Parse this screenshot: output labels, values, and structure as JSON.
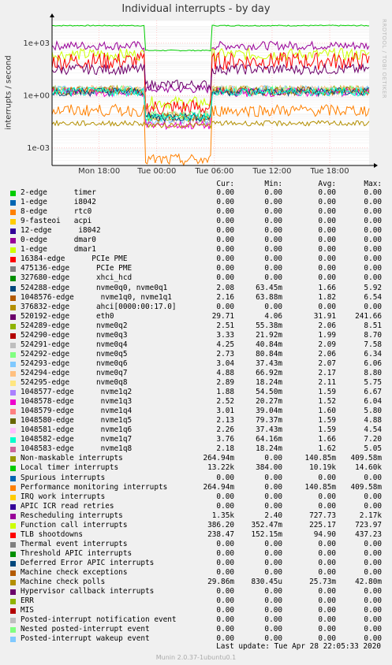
{
  "title": "Individual interrupts - by day",
  "y_axis_label": "interrupts / second",
  "side_label": "RRDTOOL / TOBI OETIKER",
  "table_headers": [
    "Cur:",
    "Min:",
    "Avg:",
    "Max:"
  ],
  "rows": [
    {
      "name": "2-edge      timer",
      "color": "#00cc00",
      "cur": "0.00",
      "min": "0.00",
      "avg": "0.00",
      "max": "0.00"
    },
    {
      "name": "1-edge      i8042",
      "color": "#0066b3",
      "cur": "0.00",
      "min": "0.00",
      "avg": "0.00",
      "max": "0.00"
    },
    {
      "name": "8-edge      rtc0",
      "color": "#ff8000",
      "cur": "0.00",
      "min": "0.00",
      "avg": "0.00",
      "max": "0.00"
    },
    {
      "name": "9-fasteoi   acpi",
      "color": "#ffcc00",
      "cur": "0.00",
      "min": "0.00",
      "avg": "0.00",
      "max": "0.00"
    },
    {
      "name": "12-edge      i8042",
      "color": "#330099",
      "cur": "0.00",
      "min": "0.00",
      "avg": "0.00",
      "max": "0.00"
    },
    {
      "name": "0-edge      dmar0",
      "color": "#990099",
      "cur": "0.00",
      "min": "0.00",
      "avg": "0.00",
      "max": "0.00"
    },
    {
      "name": "1-edge      dmar1",
      "color": "#ccff00",
      "cur": "0.00",
      "min": "0.00",
      "avg": "0.00",
      "max": "0.00"
    },
    {
      "name": "16384-edge      PCIe PME",
      "color": "#ff0000",
      "cur": "0.00",
      "min": "0.00",
      "avg": "0.00",
      "max": "0.00"
    },
    {
      "name": "475136-edge      PCIe PME",
      "color": "#808080",
      "cur": "0.00",
      "min": "0.00",
      "avg": "0.00",
      "max": "0.00"
    },
    {
      "name": "327680-edge      xhci_hcd",
      "color": "#008f00",
      "cur": "0.00",
      "min": "0.00",
      "avg": "0.00",
      "max": "0.00"
    },
    {
      "name": "524288-edge      nvme0q0, nvme0q1",
      "color": "#00487d",
      "cur": "2.08",
      "min": "63.45m",
      "avg": "1.66",
      "max": "5.92"
    },
    {
      "name": "1048576-edge      nvme1q0, nvme1q1",
      "color": "#b35a00",
      "cur": "2.16",
      "min": "63.88m",
      "avg": "1.82",
      "max": "6.54"
    },
    {
      "name": "376832-edge      ahci[0000:00:17.0]",
      "color": "#b38f00",
      "cur": "0.00",
      "min": "0.00",
      "avg": "0.00",
      "max": "0.00"
    },
    {
      "name": "520192-edge      eth0",
      "color": "#6b006b",
      "cur": "29.71",
      "min": "4.06",
      "avg": "31.91",
      "max": "241.66"
    },
    {
      "name": "524289-edge      nvme0q2",
      "color": "#8fb300",
      "cur": "2.51",
      "min": "55.38m",
      "avg": "2.06",
      "max": "8.51"
    },
    {
      "name": "524290-edge      nvme0q3",
      "color": "#b30000",
      "cur": "3.33",
      "min": "21.92m",
      "avg": "1.99",
      "max": "8.70"
    },
    {
      "name": "524291-edge      nvme0q4",
      "color": "#bebebe",
      "cur": "4.25",
      "min": "40.84m",
      "avg": "2.09",
      "max": "7.58"
    },
    {
      "name": "524292-edge      nvme0q5",
      "color": "#80ff80",
      "cur": "2.73",
      "min": "80.84m",
      "avg": "2.06",
      "max": "6.34"
    },
    {
      "name": "524293-edge      nvme0q6",
      "color": "#80c9ff",
      "cur": "3.04",
      "min": "37.43m",
      "avg": "2.07",
      "max": "6.06"
    },
    {
      "name": "524294-edge      nvme0q7",
      "color": "#ffc080",
      "cur": "4.88",
      "min": "66.92m",
      "avg": "2.17",
      "max": "8.80"
    },
    {
      "name": "524295-edge      nvme0q8",
      "color": "#ffe680",
      "cur": "2.89",
      "min": "18.24m",
      "avg": "2.11",
      "max": "5.75"
    },
    {
      "name": "1048577-edge      nvme1q2",
      "color": "#aa80ff",
      "cur": "1.88",
      "min": "54.50m",
      "avg": "1.59",
      "max": "6.67"
    },
    {
      "name": "1048578-edge      nvme1q3",
      "color": "#ee00cc",
      "cur": "2.52",
      "min": "20.27m",
      "avg": "1.52",
      "max": "6.04"
    },
    {
      "name": "1048579-edge      nvme1q4",
      "color": "#ff8080",
      "cur": "3.01",
      "min": "39.04m",
      "avg": "1.60",
      "max": "5.80"
    },
    {
      "name": "1048580-edge      nvme1q5",
      "color": "#666600",
      "cur": "2.13",
      "min": "79.37m",
      "avg": "1.59",
      "max": "4.88"
    },
    {
      "name": "1048581-edge      nvme1q6",
      "color": "#ffbfff",
      "cur": "2.26",
      "min": "37.43m",
      "avg": "1.59",
      "max": "4.54"
    },
    {
      "name": "1048582-edge      nvme1q7",
      "color": "#00ffcc",
      "cur": "3.76",
      "min": "64.16m",
      "avg": "1.66",
      "max": "7.20"
    },
    {
      "name": "1048583-edge      nvme1q8",
      "color": "#cc6699",
      "cur": "2.18",
      "min": "18.24m",
      "avg": "1.62",
      "max": "5.05"
    },
    {
      "name": "Non-maskable interrupts",
      "color": "#999900",
      "cur": "264.94m",
      "min": "0.00",
      "avg": "140.85m",
      "max": "409.58m"
    },
    {
      "name": "Local timer interrupts",
      "color": "#00cc00",
      "cur": "13.22k",
      "min": "384.00",
      "avg": "10.19k",
      "max": "14.60k"
    },
    {
      "name": "Spurious interrupts",
      "color": "#0066b3",
      "cur": "0.00",
      "min": "0.00",
      "avg": "0.00",
      "max": "0.00"
    },
    {
      "name": "Performance monitoring interrupts",
      "color": "#ff8000",
      "cur": "264.94m",
      "min": "0.00",
      "avg": "140.85m",
      "max": "409.58m"
    },
    {
      "name": "IRQ work interrupts",
      "color": "#ffcc00",
      "cur": "0.00",
      "min": "0.00",
      "avg": "0.00",
      "max": "0.00"
    },
    {
      "name": "APIC ICR read retries",
      "color": "#330099",
      "cur": "0.00",
      "min": "0.00",
      "avg": "0.00",
      "max": "0.00"
    },
    {
      "name": "Rescheduling interrupts",
      "color": "#990099",
      "cur": "1.35k",
      "min": "2.40",
      "avg": "727.73",
      "max": "2.17k"
    },
    {
      "name": "Function call interrupts",
      "color": "#ccff00",
      "cur": "386.20",
      "min": "352.47m",
      "avg": "225.17",
      "max": "723.97"
    },
    {
      "name": "TLB shootdowns",
      "color": "#ff0000",
      "cur": "238.47",
      "min": "152.15m",
      "avg": "94.90",
      "max": "437.23"
    },
    {
      "name": "Thermal event interrupts",
      "color": "#808080",
      "cur": "0.00",
      "min": "0.00",
      "avg": "0.00",
      "max": "0.00"
    },
    {
      "name": "Threshold APIC interrupts",
      "color": "#008f00",
      "cur": "0.00",
      "min": "0.00",
      "avg": "0.00",
      "max": "0.00"
    },
    {
      "name": "Deferred Error APIC interrupts",
      "color": "#00487d",
      "cur": "0.00",
      "min": "0.00",
      "avg": "0.00",
      "max": "0.00"
    },
    {
      "name": "Machine check exceptions",
      "color": "#b35a00",
      "cur": "0.00",
      "min": "0.00",
      "avg": "0.00",
      "max": "0.00"
    },
    {
      "name": "Machine check polls",
      "color": "#b38f00",
      "cur": "29.86m",
      "min": "830.45u",
      "avg": "25.73m",
      "max": "42.80m"
    },
    {
      "name": "Hypervisor callback interrupts",
      "color": "#6b006b",
      "cur": "0.00",
      "min": "0.00",
      "avg": "0.00",
      "max": "0.00"
    },
    {
      "name": "ERR",
      "color": "#8fb300",
      "cur": "0.00",
      "min": "0.00",
      "avg": "0.00",
      "max": "0.00"
    },
    {
      "name": "MIS",
      "color": "#b30000",
      "cur": "0.00",
      "min": "0.00",
      "avg": "0.00",
      "max": "0.00"
    },
    {
      "name": "Posted-interrupt notification event",
      "color": "#bebebe",
      "cur": "0.00",
      "min": "0.00",
      "avg": "0.00",
      "max": "0.00"
    },
    {
      "name": "Nested posted-interrupt event",
      "color": "#80ff80",
      "cur": "0.00",
      "min": "0.00",
      "avg": "0.00",
      "max": "0.00"
    },
    {
      "name": "Posted-interrupt wakeup event",
      "color": "#80c9ff",
      "cur": "0.00",
      "min": "0.00",
      "avg": "0.00",
      "max": "0.00"
    }
  ],
  "last_update": "Last update: Tue Apr 28 22:05:33 2020",
  "footer": "Munin 2.0.37-1ubuntu0.1",
  "chart_data": {
    "type": "line",
    "y_scale": "log",
    "ylim": [
      0.0001,
      20000
    ],
    "y_ticks": [
      "1e+03",
      "1e+00",
      "1e-03"
    ],
    "y_tick_values": [
      1000,
      1,
      0.001
    ],
    "x_tick_labels": [
      "Mon 18:00",
      "Tue 00:00",
      "Tue 06:00",
      "Tue 12:00",
      "Tue 18:00"
    ],
    "x_tick_hours": [
      18,
      24,
      30,
      36,
      42
    ],
    "x_range_hours": [
      13.1,
      46.1
    ],
    "gap_hours": [
      22.7,
      29.6
    ],
    "series": [
      {
        "name": "Local timer interrupts",
        "color": "#00cc00",
        "level": 10190,
        "gap_level": 384,
        "noise": 0.03
      },
      {
        "name": "Rescheduling interrupts",
        "color": "#990099",
        "level": 727.73,
        "gap_level": 2.4,
        "noise": 0.25
      },
      {
        "name": "Function call interrupts",
        "color": "#ccff00",
        "level": 225.17,
        "gap_level": 0.4,
        "noise": 0.35
      },
      {
        "name": "TLB shootdowns",
        "color": "#ff0000",
        "level": 94.9,
        "gap_level": 0.2,
        "noise": 0.5
      },
      {
        "name": "520192-edge      eth0",
        "color": "#6b006b",
        "level": 31.91,
        "gap_level": 4.06,
        "noise": 0.3
      },
      {
        "name": "524291-edge      nvme0q4",
        "color": "#bebebe",
        "level": 2.09,
        "gap_level": 0.04,
        "noise": 0.25
      },
      {
        "name": "524289-edge      nvme0q2",
        "color": "#8fb300",
        "level": 2.06,
        "gap_level": 0.05,
        "noise": 0.25
      },
      {
        "name": "524292-edge      nvme0q5",
        "color": "#80ff80",
        "level": 2.06,
        "gap_level": 0.08,
        "noise": 0.25
      },
      {
        "name": "524293-edge      nvme0q6",
        "color": "#80c9ff",
        "level": 2.07,
        "gap_level": 0.04,
        "noise": 0.25
      },
      {
        "name": "524294-edge      nvme0q7",
        "color": "#ffc080",
        "level": 2.17,
        "gap_level": 0.07,
        "noise": 0.25
      },
      {
        "name": "1048578-edge      nvme1q3",
        "color": "#ee00cc",
        "level": 1.52,
        "gap_level": 0.02,
        "noise": 0.25
      },
      {
        "name": "1048576-edge      nvme1q0, nvme1q1",
        "color": "#b35a00",
        "level": 1.82,
        "gap_level": 0.06,
        "noise": 0.25
      },
      {
        "name": "524288-edge      nvme0q0, nvme0q1",
        "color": "#00487d",
        "level": 1.66,
        "gap_level": 0.06,
        "noise": 0.25
      },
      {
        "name": "1048582-edge      nvme1q7",
        "color": "#00ffcc",
        "level": 1.66,
        "gap_level": 0.06,
        "noise": 0.25
      },
      {
        "name": "Performance monitoring interrupts",
        "color": "#ff8000",
        "level": 0.14085,
        "gap_level": 0.0002,
        "noise": 0.35
      },
      {
        "name": "Machine check polls",
        "color": "#b38f00",
        "level": 0.02573,
        "gap_level": 0.02,
        "noise": 0.15
      }
    ]
  }
}
